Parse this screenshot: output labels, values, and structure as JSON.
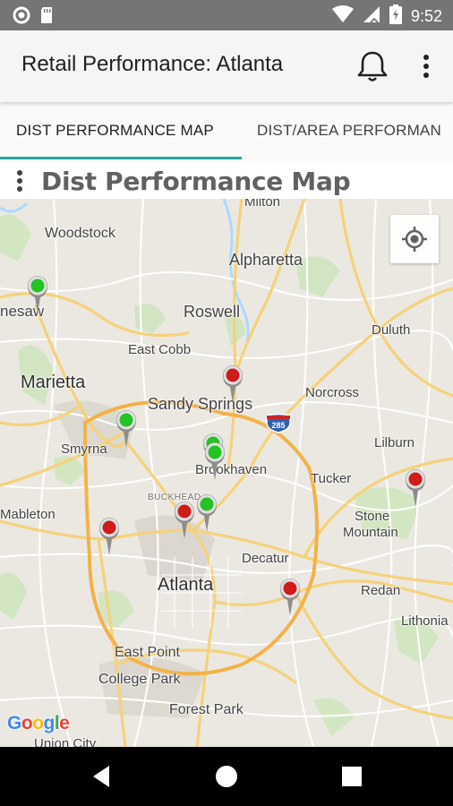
{
  "status_bar": {
    "time": "9:52",
    "icons": [
      "circle-status-icon",
      "sd-card-icon",
      "wifi-icon",
      "signal-icon",
      "battery-charging-icon"
    ]
  },
  "app_bar": {
    "title": "Retail Performance: Atlanta",
    "actions": [
      "bell-icon",
      "more-vert-icon"
    ]
  },
  "tabs": [
    {
      "label": "DIST PERFORMANCE MAP",
      "selected": true
    },
    {
      "label": "DIST/AREA PERFORMAN",
      "selected": false
    }
  ],
  "section": {
    "title": "Dist Performance Map"
  },
  "map": {
    "places": {
      "milton": "Milton",
      "woodstock": "Woodstock",
      "alpharetta": "Alpharetta",
      "roswell": "Roswell",
      "kennesaw": "nesaw",
      "duluth": "Duluth",
      "east_cobb": "East Cobb",
      "marietta": "Marietta",
      "sandy_springs": "Sandy Springs",
      "norcross": "Norcross",
      "smyrna": "Smyrna",
      "lilburn": "Lilburn",
      "brookhaven": "Brookhaven",
      "buckhead": "BUCKHEAD",
      "tucker": "Tucker",
      "mableton": "Mableton",
      "stone_mountain_1": "Stone",
      "stone_mountain_2": "Mountain",
      "decatur": "Decatur",
      "atlanta": "Atlanta",
      "redan": "Redan",
      "lithonia": "Lithonia",
      "east_point": "East Point",
      "college_park": "College Park",
      "forest_park": "Forest Park",
      "union_city": "Union City"
    },
    "highway_shield": "285",
    "attribution": "Google",
    "marker_colors": {
      "green": "#22c322",
      "red": "#d11a1a"
    },
    "markers": [
      {
        "status": "green",
        "near": "Kennesaw"
      },
      {
        "status": "red",
        "near": "Sandy Springs"
      },
      {
        "status": "green",
        "near": "Smyrna"
      },
      {
        "status": "green",
        "near": "Brookhaven"
      },
      {
        "status": "green",
        "near": "Brookhaven"
      },
      {
        "status": "red",
        "near": "Buckhead"
      },
      {
        "status": "green",
        "near": "Buckhead"
      },
      {
        "status": "red",
        "near": "Mableton"
      },
      {
        "status": "red",
        "near": "Stone Mountain"
      },
      {
        "status": "red",
        "near": "Decatur"
      }
    ],
    "controls": [
      "my-location-icon"
    ]
  },
  "nav_bar": {
    "buttons": [
      "back-icon",
      "home-icon",
      "recents-icon"
    ]
  }
}
